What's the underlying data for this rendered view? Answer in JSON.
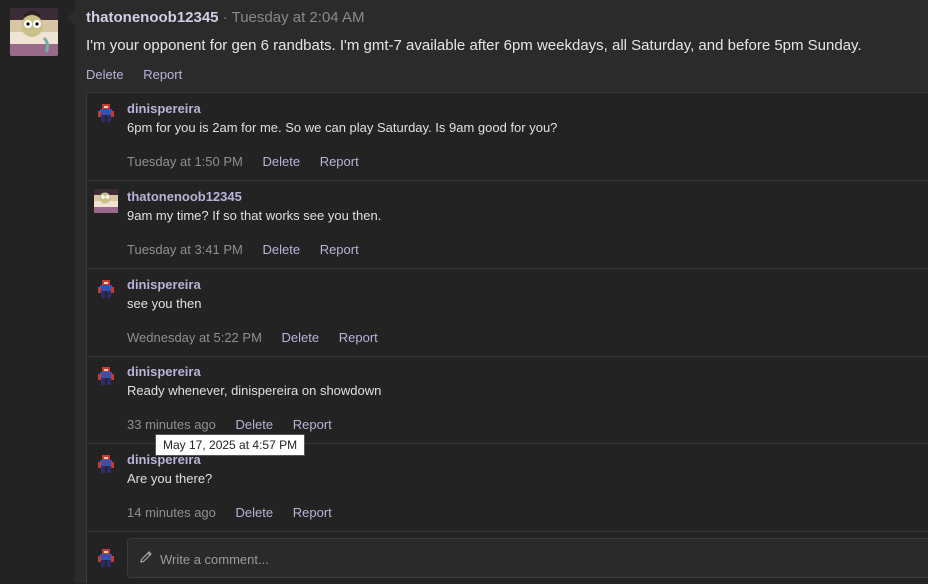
{
  "post": {
    "username": "thatonenoob12345",
    "separator": "·",
    "timestamp": "Tuesday at 2:04 AM",
    "body": "I'm your opponent for gen 6 randbats. I'm gmt-7 available after 6pm weekdays, all Saturday, and before 5pm Sunday.",
    "actions": {
      "delete": "Delete",
      "report": "Report"
    },
    "avatar_icon": "cartoon-avatar-icon"
  },
  "comments": [
    {
      "username": "dinispereira",
      "text": "6pm for you is 2am for me. So we can play Saturday. Is 9am good for you?",
      "timestamp": "Tuesday at 1:50 PM",
      "delete": "Delete",
      "report": "Report"
    },
    {
      "username": "thatonenoob12345",
      "text": "9am my time? If so that works see you then.",
      "timestamp": "Tuesday at 3:41 PM",
      "delete": "Delete",
      "report": "Report"
    },
    {
      "username": "dinispereira",
      "text": "see you then",
      "timestamp": "Wednesday at 5:22 PM",
      "delete": "Delete",
      "report": "Report"
    },
    {
      "username": "dinispereira",
      "text": "Ready whenever, dinispereira on showdown",
      "timestamp": "33 minutes ago",
      "delete": "Delete",
      "report": "Report"
    },
    {
      "username": "dinispereira",
      "text": "Are you there?",
      "timestamp": "14 minutes ago",
      "delete": "Delete",
      "report": "Report"
    }
  ],
  "tooltip": {
    "text": "May 17, 2025 at 4:57 PM"
  },
  "reply": {
    "placeholder": "Write a comment...",
    "icon": "pencil-icon"
  },
  "colors": {
    "accent": "#b9b3d8",
    "background": "#2b2b2b",
    "panel": "#232323"
  }
}
